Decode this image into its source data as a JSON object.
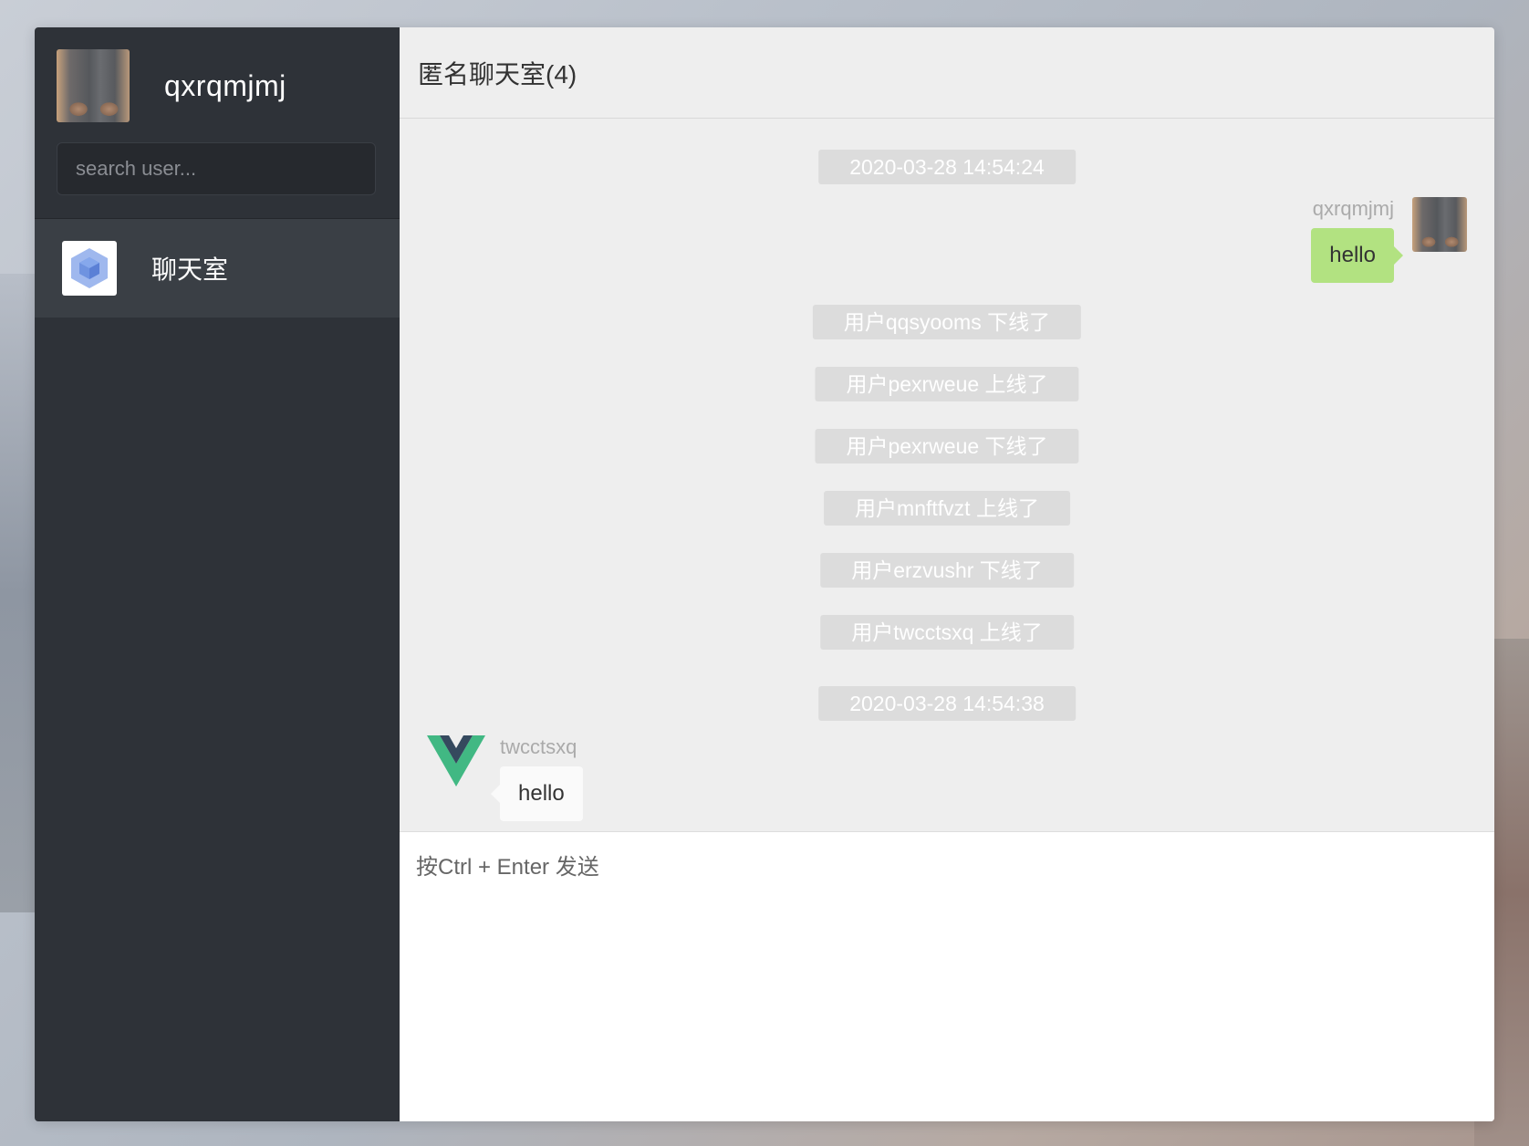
{
  "user": {
    "name": "qxrqmjmj"
  },
  "search": {
    "placeholder": "search user..."
  },
  "rooms": [
    {
      "name": "聊天室"
    }
  ],
  "header": {
    "title": "匿名聊天室(4)"
  },
  "system_messages": [
    "2020-03-28 14:54:24",
    "用户qqsyooms 下线了",
    "用户pexrweue 上线了",
    "用户pexrweue 下线了",
    "用户mnftfvzt 上线了",
    "用户erzvushr 下线了",
    "用户twcctsxq 上线了",
    "2020-03-28 14:54:38"
  ],
  "messages": [
    {
      "sender": "qxrqmjmj",
      "text": "hello",
      "self": true
    },
    {
      "sender": "twcctsxq",
      "text": "hello",
      "self": false
    }
  ],
  "composer": {
    "placeholder": "按Ctrl + Enter 发送"
  },
  "colors": {
    "sidebar": "#2e3238",
    "self_bubble": "#b2e281",
    "system_pill": "#dcdcdc"
  }
}
